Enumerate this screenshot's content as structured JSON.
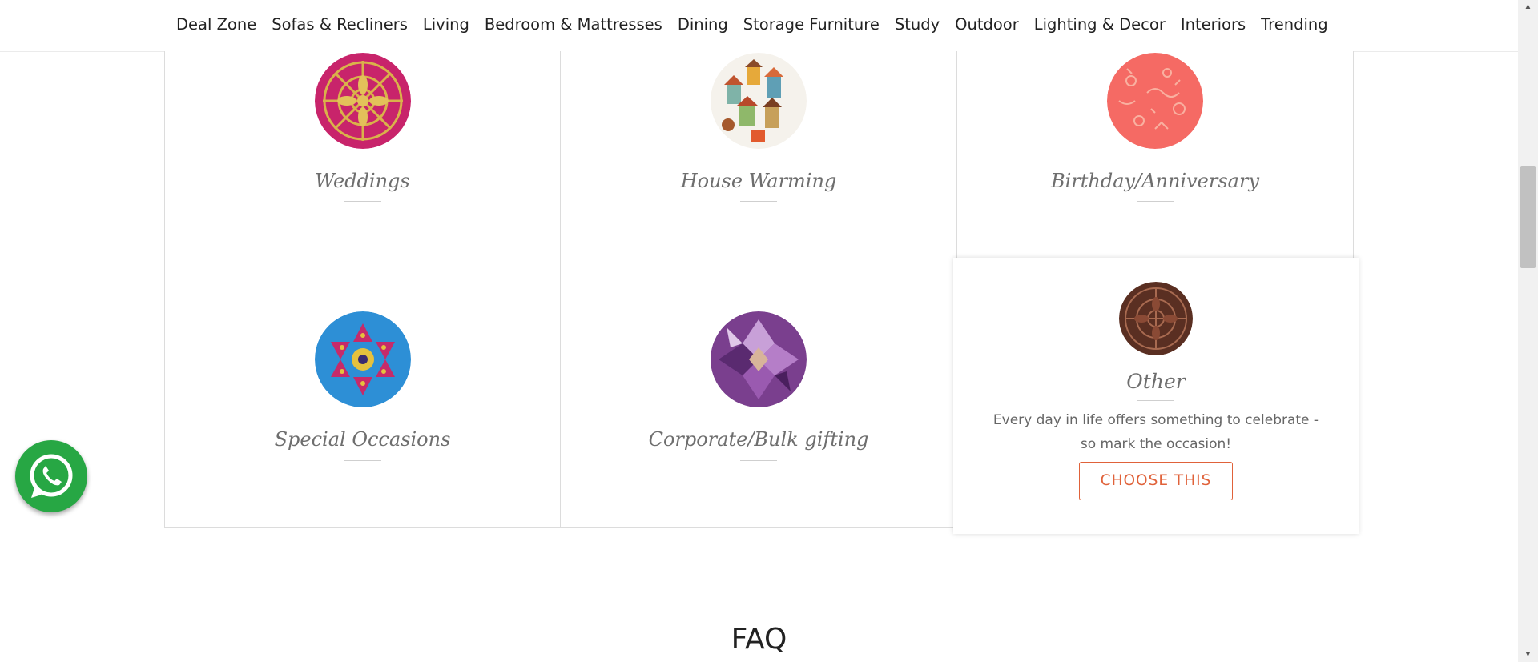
{
  "nav": {
    "items": [
      "Deal Zone",
      "Sofas & Recliners",
      "Living",
      "Bedroom & Mattresses",
      "Dining",
      "Storage Furniture",
      "Study",
      "Outdoor",
      "Lighting & Decor",
      "Interiors",
      "Trending"
    ]
  },
  "occasions": [
    {
      "title": "Weddings",
      "image": "ornate-pink-gold-pattern"
    },
    {
      "title": "House Warming",
      "image": "birdhouse-pattern"
    },
    {
      "title": "Birthday/Anniversary",
      "image": "coral-doodle-pattern"
    },
    {
      "title": "Special Occasions",
      "image": "kaleidoscope-blue-pink-pattern"
    },
    {
      "title": "Corporate/Bulk gifting",
      "image": "purple-geometric-kaleidoscope"
    }
  ],
  "highlight": {
    "title": "Other",
    "description": "Every day in life offers something to celebrate - so mark the occasion!",
    "button_label": "CHOOSE THIS",
    "image": "brown-paisley-pattern"
  },
  "faq": {
    "heading": "FAQ"
  },
  "colors": {
    "accent": "#e0623a",
    "whatsapp": "#27a744"
  },
  "icons": {
    "whatsapp": "whatsapp-icon",
    "scroll_up": "scroll-up-arrow-icon",
    "scroll_down": "scroll-down-arrow-icon"
  }
}
